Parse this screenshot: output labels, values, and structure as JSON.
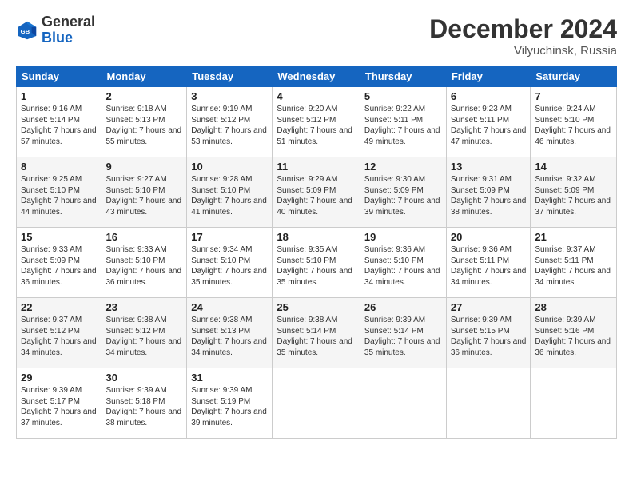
{
  "logo": {
    "general": "General",
    "blue": "Blue"
  },
  "header": {
    "month": "December 2024",
    "location": "Vilyuchinsk, Russia"
  },
  "weekdays": [
    "Sunday",
    "Monday",
    "Tuesday",
    "Wednesday",
    "Thursday",
    "Friday",
    "Saturday"
  ],
  "weeks": [
    [
      {
        "day": "1",
        "sunrise": "Sunrise: 9:16 AM",
        "sunset": "Sunset: 5:14 PM",
        "daylight": "Daylight: 7 hours and 57 minutes."
      },
      {
        "day": "2",
        "sunrise": "Sunrise: 9:18 AM",
        "sunset": "Sunset: 5:13 PM",
        "daylight": "Daylight: 7 hours and 55 minutes."
      },
      {
        "day": "3",
        "sunrise": "Sunrise: 9:19 AM",
        "sunset": "Sunset: 5:12 PM",
        "daylight": "Daylight: 7 hours and 53 minutes."
      },
      {
        "day": "4",
        "sunrise": "Sunrise: 9:20 AM",
        "sunset": "Sunset: 5:12 PM",
        "daylight": "Daylight: 7 hours and 51 minutes."
      },
      {
        "day": "5",
        "sunrise": "Sunrise: 9:22 AM",
        "sunset": "Sunset: 5:11 PM",
        "daylight": "Daylight: 7 hours and 49 minutes."
      },
      {
        "day": "6",
        "sunrise": "Sunrise: 9:23 AM",
        "sunset": "Sunset: 5:11 PM",
        "daylight": "Daylight: 7 hours and 47 minutes."
      },
      {
        "day": "7",
        "sunrise": "Sunrise: 9:24 AM",
        "sunset": "Sunset: 5:10 PM",
        "daylight": "Daylight: 7 hours and 46 minutes."
      }
    ],
    [
      {
        "day": "8",
        "sunrise": "Sunrise: 9:25 AM",
        "sunset": "Sunset: 5:10 PM",
        "daylight": "Daylight: 7 hours and 44 minutes."
      },
      {
        "day": "9",
        "sunrise": "Sunrise: 9:27 AM",
        "sunset": "Sunset: 5:10 PM",
        "daylight": "Daylight: 7 hours and 43 minutes."
      },
      {
        "day": "10",
        "sunrise": "Sunrise: 9:28 AM",
        "sunset": "Sunset: 5:10 PM",
        "daylight": "Daylight: 7 hours and 41 minutes."
      },
      {
        "day": "11",
        "sunrise": "Sunrise: 9:29 AM",
        "sunset": "Sunset: 5:09 PM",
        "daylight": "Daylight: 7 hours and 40 minutes."
      },
      {
        "day": "12",
        "sunrise": "Sunrise: 9:30 AM",
        "sunset": "Sunset: 5:09 PM",
        "daylight": "Daylight: 7 hours and 39 minutes."
      },
      {
        "day": "13",
        "sunrise": "Sunrise: 9:31 AM",
        "sunset": "Sunset: 5:09 PM",
        "daylight": "Daylight: 7 hours and 38 minutes."
      },
      {
        "day": "14",
        "sunrise": "Sunrise: 9:32 AM",
        "sunset": "Sunset: 5:09 PM",
        "daylight": "Daylight: 7 hours and 37 minutes."
      }
    ],
    [
      {
        "day": "15",
        "sunrise": "Sunrise: 9:33 AM",
        "sunset": "Sunset: 5:09 PM",
        "daylight": "Daylight: 7 hours and 36 minutes."
      },
      {
        "day": "16",
        "sunrise": "Sunrise: 9:33 AM",
        "sunset": "Sunset: 5:10 PM",
        "daylight": "Daylight: 7 hours and 36 minutes."
      },
      {
        "day": "17",
        "sunrise": "Sunrise: 9:34 AM",
        "sunset": "Sunset: 5:10 PM",
        "daylight": "Daylight: 7 hours and 35 minutes."
      },
      {
        "day": "18",
        "sunrise": "Sunrise: 9:35 AM",
        "sunset": "Sunset: 5:10 PM",
        "daylight": "Daylight: 7 hours and 35 minutes."
      },
      {
        "day": "19",
        "sunrise": "Sunrise: 9:36 AM",
        "sunset": "Sunset: 5:10 PM",
        "daylight": "Daylight: 7 hours and 34 minutes."
      },
      {
        "day": "20",
        "sunrise": "Sunrise: 9:36 AM",
        "sunset": "Sunset: 5:11 PM",
        "daylight": "Daylight: 7 hours and 34 minutes."
      },
      {
        "day": "21",
        "sunrise": "Sunrise: 9:37 AM",
        "sunset": "Sunset: 5:11 PM",
        "daylight": "Daylight: 7 hours and 34 minutes."
      }
    ],
    [
      {
        "day": "22",
        "sunrise": "Sunrise: 9:37 AM",
        "sunset": "Sunset: 5:12 PM",
        "daylight": "Daylight: 7 hours and 34 minutes."
      },
      {
        "day": "23",
        "sunrise": "Sunrise: 9:38 AM",
        "sunset": "Sunset: 5:12 PM",
        "daylight": "Daylight: 7 hours and 34 minutes."
      },
      {
        "day": "24",
        "sunrise": "Sunrise: 9:38 AM",
        "sunset": "Sunset: 5:13 PM",
        "daylight": "Daylight: 7 hours and 34 minutes."
      },
      {
        "day": "25",
        "sunrise": "Sunrise: 9:38 AM",
        "sunset": "Sunset: 5:14 PM",
        "daylight": "Daylight: 7 hours and 35 minutes."
      },
      {
        "day": "26",
        "sunrise": "Sunrise: 9:39 AM",
        "sunset": "Sunset: 5:14 PM",
        "daylight": "Daylight: 7 hours and 35 minutes."
      },
      {
        "day": "27",
        "sunrise": "Sunrise: 9:39 AM",
        "sunset": "Sunset: 5:15 PM",
        "daylight": "Daylight: 7 hours and 36 minutes."
      },
      {
        "day": "28",
        "sunrise": "Sunrise: 9:39 AM",
        "sunset": "Sunset: 5:16 PM",
        "daylight": "Daylight: 7 hours and 36 minutes."
      }
    ],
    [
      {
        "day": "29",
        "sunrise": "Sunrise: 9:39 AM",
        "sunset": "Sunset: 5:17 PM",
        "daylight": "Daylight: 7 hours and 37 minutes."
      },
      {
        "day": "30",
        "sunrise": "Sunrise: 9:39 AM",
        "sunset": "Sunset: 5:18 PM",
        "daylight": "Daylight: 7 hours and 38 minutes."
      },
      {
        "day": "31",
        "sunrise": "Sunrise: 9:39 AM",
        "sunset": "Sunset: 5:19 PM",
        "daylight": "Daylight: 7 hours and 39 minutes."
      },
      null,
      null,
      null,
      null
    ]
  ]
}
